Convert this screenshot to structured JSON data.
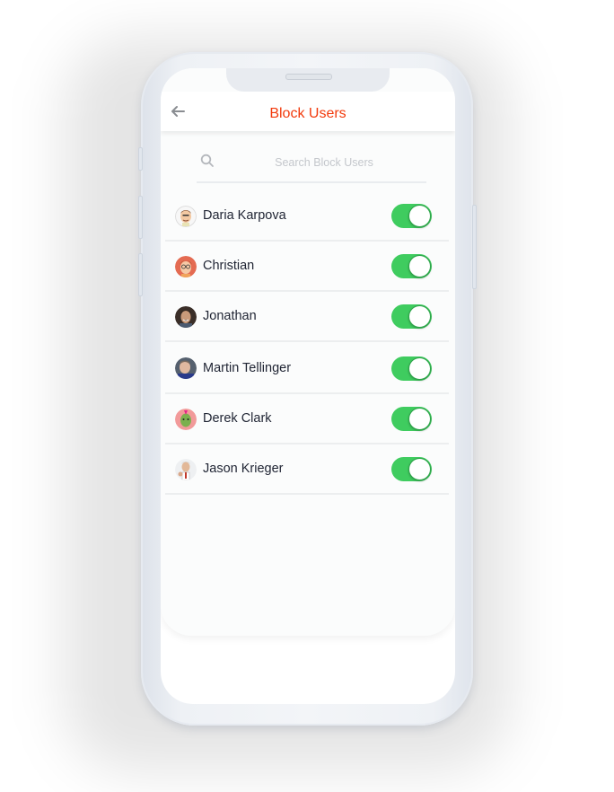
{
  "header": {
    "title": "Block Users",
    "back_icon": "arrow-left-icon"
  },
  "search": {
    "placeholder": "Search Block Users",
    "value": "",
    "icon": "search-icon"
  },
  "colors": {
    "title": "#f23a0c",
    "toggle_on": "#3fcc5f"
  },
  "users": [
    {
      "name": "Daria Karpova",
      "blocked": true
    },
    {
      "name": "Christian",
      "blocked": true
    },
    {
      "name": "Jonathan",
      "blocked": true
    },
    {
      "name": "Martin Tellinger",
      "blocked": true
    },
    {
      "name": "Derek Clark",
      "blocked": true
    },
    {
      "name": "Jason Krieger",
      "blocked": true
    }
  ]
}
